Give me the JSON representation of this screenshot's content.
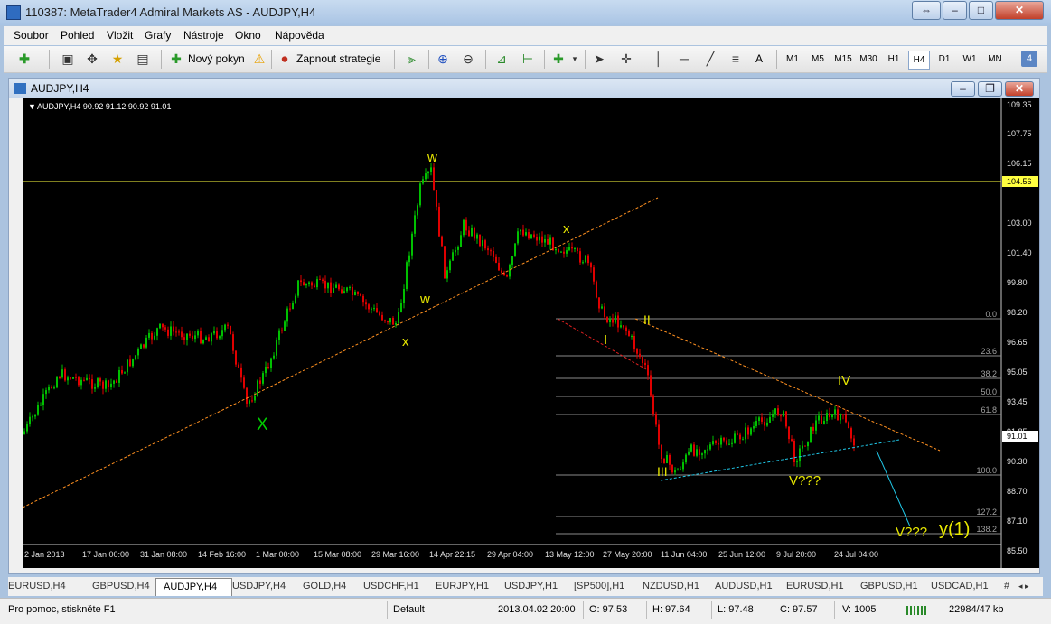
{
  "window": {
    "title": "110387: MetaTrader4 Admiral Markets AS - AUDJPY,H4"
  },
  "menu": [
    "Soubor",
    "Pohled",
    "Vložit",
    "Grafy",
    "Nástroje",
    "Okno",
    "Nápověda"
  ],
  "toolbar": {
    "new_order": "Nový pokyn",
    "auto_trading": "Zapnout strategie",
    "text_tool": "A",
    "timeframes": [
      "M1",
      "M5",
      "M15",
      "M30",
      "H1",
      "H4",
      "D1",
      "W1",
      "MN"
    ],
    "active_timeframe": "H4",
    "badge": "4"
  },
  "chart_window": {
    "title": "AUDJPY,H4"
  },
  "chart": {
    "header": "AUDJPY,H4  90.92 91.12 90.92 91.01",
    "price_axis": [
      "109.35",
      "107.75",
      "106.15",
      "104.56",
      "103.00",
      "101.40",
      "99.80",
      "98.20",
      "96.65",
      "95.05",
      "93.45",
      "91.85",
      "90.30",
      "88.70",
      "87.10",
      "85.50"
    ],
    "time_axis": [
      "2 Jan 2013",
      "17 Jan 00:00",
      "31 Jan 08:00",
      "14 Feb 16:00",
      "1 Mar 00:00",
      "15 Mar 08:00",
      "29 Mar 16:00",
      "14 Apr 22:15",
      "29 Apr 04:00",
      "13 May 12:00",
      "27 May 20:00",
      "11 Jun 04:00",
      "25 Jun 12:00",
      "9 Jul 20:00",
      "24 Jul 04:00"
    ],
    "hline_label": "104.56",
    "current_price": "91.01",
    "fib_levels": [
      "0.0",
      "23.6",
      "38.2",
      "50.0",
      "61.8",
      "100.0",
      "127.2",
      "138.2"
    ],
    "wave_labels": {
      "X_green": "X",
      "w_top": "w",
      "w_mid": "w",
      "x_low": "x",
      "x_top": "x",
      "I": "I",
      "II": "II",
      "III": "III",
      "IV": "IV",
      "V1": "V???",
      "V2": "V???",
      "y1": "y(1)"
    },
    "colors": {
      "background": "#000000",
      "bull": "#00C000",
      "bear": "#E00000",
      "hline": "#FFFF40",
      "wave_label": "#E8E800",
      "green_label": "#00D000",
      "trend": "#FF9020",
      "support": "#20C8E8",
      "fib": "#909090"
    }
  },
  "tabs": [
    "EURUSD,H4",
    "GBPUSD,H4",
    "AUDJPY,H4",
    "USDJPY,H4",
    "GOLD,H4",
    "USDCHF,H1",
    "EURJPY,H1",
    "USDJPY,H1",
    "[SP500],H1",
    "NZDUSD,H1",
    "AUDUSD,H1",
    "EURUSD,H1",
    "GBPUSD,H1",
    "USDCAD,H1",
    "#"
  ],
  "active_tab": "AUDJPY,H4",
  "status": {
    "help": "Pro pomoc, stiskněte F1",
    "profile": "Default",
    "datetime": "2013.04.02 20:00",
    "open": "O: 97.53",
    "high": "H: 97.64",
    "low": "L: 97.48",
    "close": "C: 97.57",
    "volume": "V: 1005",
    "traffic": "22984/47 kb"
  }
}
